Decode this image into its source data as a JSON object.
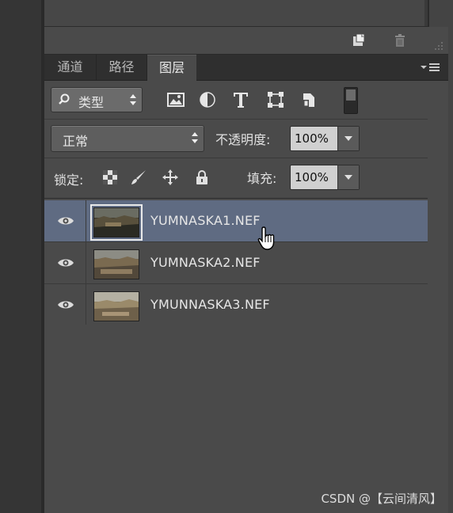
{
  "tabs": [
    {
      "label": "通道",
      "active": false
    },
    {
      "label": "路径",
      "active": false
    },
    {
      "label": "图层",
      "active": true
    }
  ],
  "filter": {
    "kind_label": "类型",
    "icons": [
      "image-filter-icon",
      "adjustment-filter-icon",
      "type-filter-icon",
      "shape-filter-icon",
      "smart-object-filter-icon"
    ]
  },
  "blend": {
    "mode": "正常",
    "opacity_label": "不透明度:",
    "opacity_value": "100%"
  },
  "lock": {
    "label": "锁定:",
    "fill_label": "填充:",
    "fill_value": "100%"
  },
  "layers": [
    {
      "name": "YUMNASKA1.NEF",
      "selected": true,
      "visible": true
    },
    {
      "name": "YUMNASKA2.NEF",
      "selected": false,
      "visible": true
    },
    {
      "name": "YMUNNASKA3.NEF",
      "selected": false,
      "visible": true
    }
  ],
  "watermark": "CSDN @【云间清风】",
  "colors": {
    "panel": "#4a4a4a",
    "selected_row": "#5f6b82",
    "tab_bar": "#2f2f2f"
  }
}
